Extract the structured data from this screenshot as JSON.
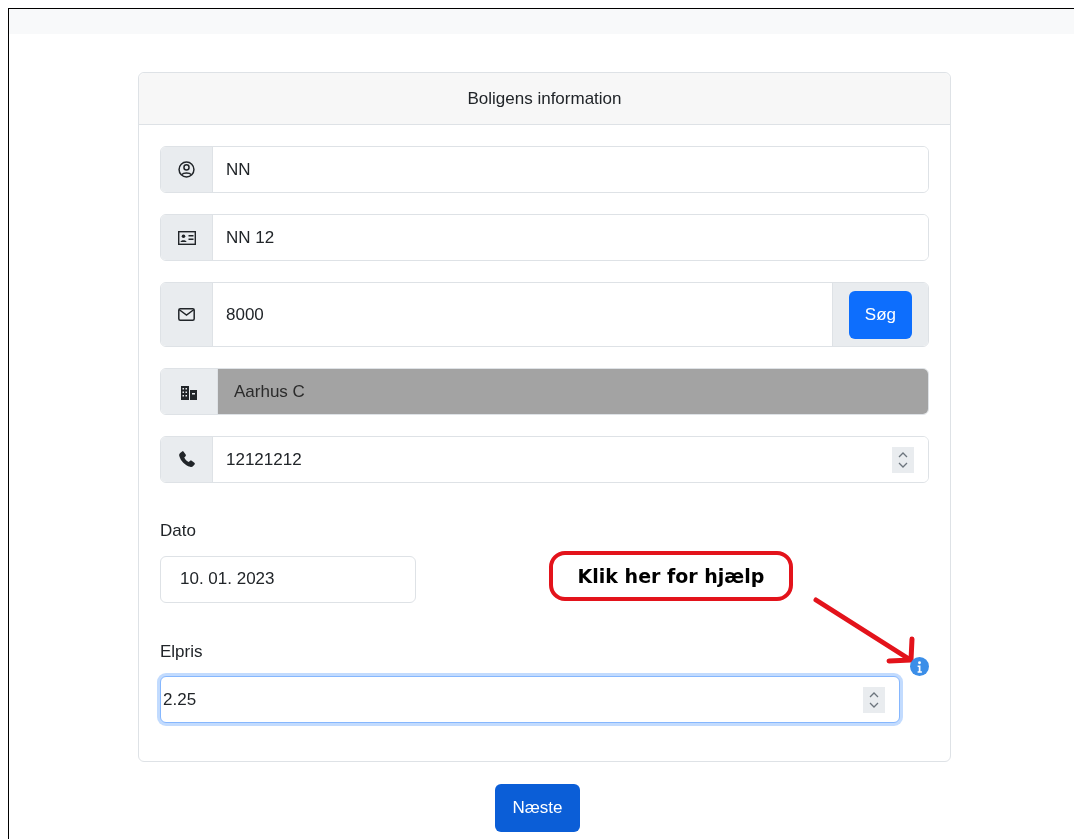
{
  "card": {
    "title": "Boligens information"
  },
  "fields": [
    {
      "kind": "text",
      "value": "NN",
      "disabled": false
    },
    {
      "kind": "text",
      "value": "NN 12",
      "disabled": false
    },
    {
      "kind": "search",
      "value": "8000",
      "button": "Søg",
      "disabled": false
    },
    {
      "kind": "text",
      "value": "Aarhus C",
      "disabled": true
    },
    {
      "kind": "number",
      "value": "12121212",
      "disabled": false
    }
  ],
  "labeled_fields": [
    {
      "label": "Dato",
      "kind": "date",
      "value": "10. 01. 2023",
      "focused": false
    },
    {
      "label": "Elpris",
      "kind": "number",
      "value": "2.25",
      "focused": true
    }
  ],
  "help_callout": {
    "text": "Klik her for hjælp"
  },
  "next_button": "Næste"
}
